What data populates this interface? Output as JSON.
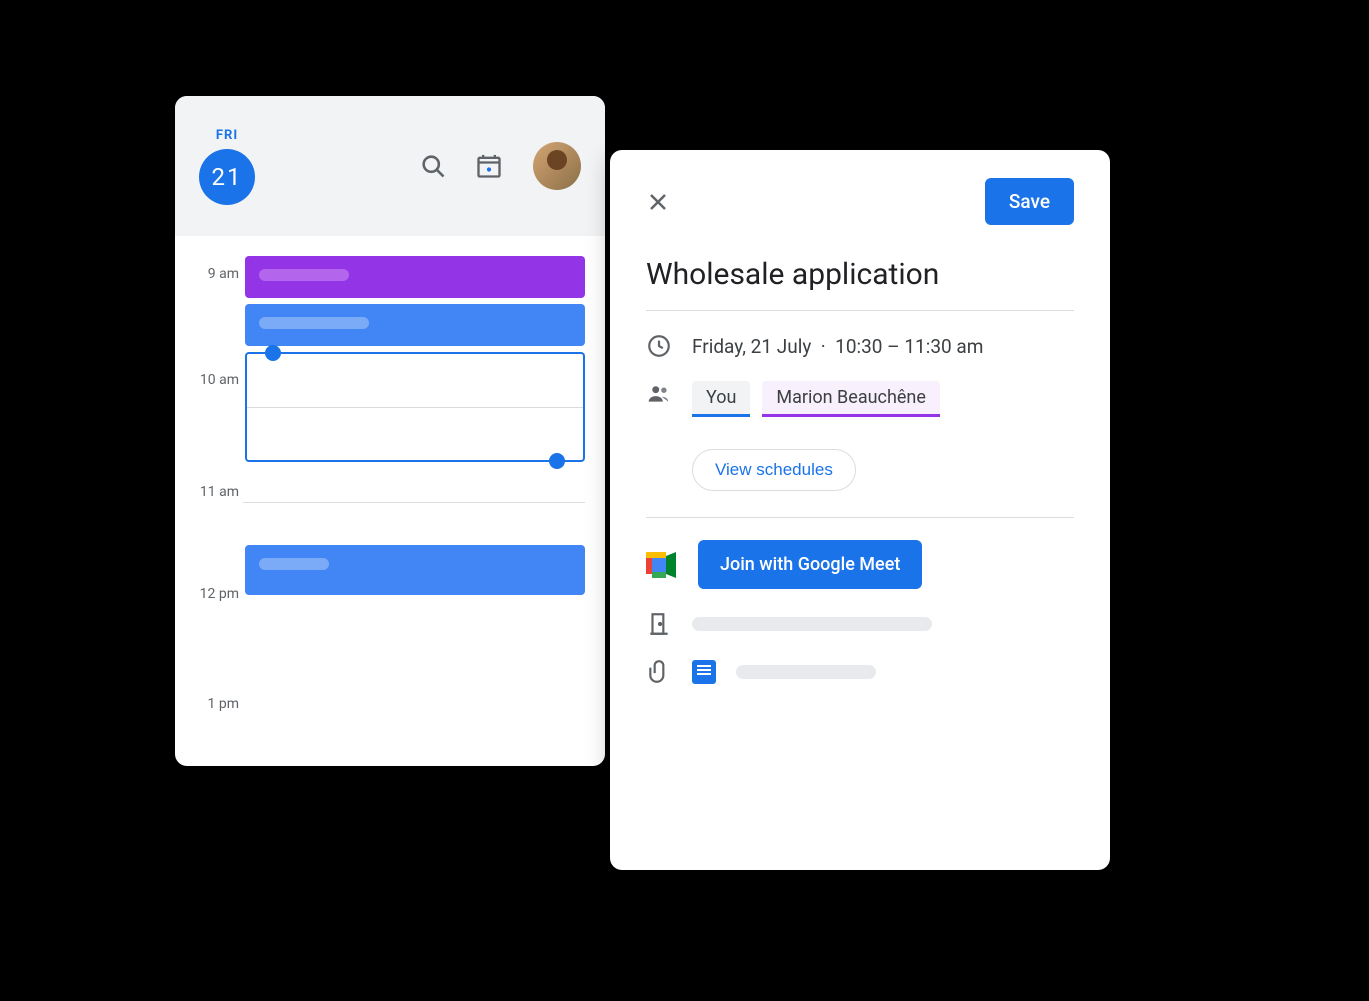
{
  "calendar": {
    "day_label": "FRI",
    "date_number": "21",
    "hours": [
      "9 am",
      "10 am",
      "11 am",
      "12 pm",
      "1 pm"
    ]
  },
  "event": {
    "title": "Wholesale application",
    "save_label": "Save",
    "date_text": "Friday, 21 July",
    "time_text": "10:30 – 11:30 am",
    "attendees": {
      "you_label": "You",
      "guest_name": "Marion Beauchêne"
    },
    "view_schedules_label": "View schedules",
    "meet_button_label": "Join with Google Meet"
  }
}
